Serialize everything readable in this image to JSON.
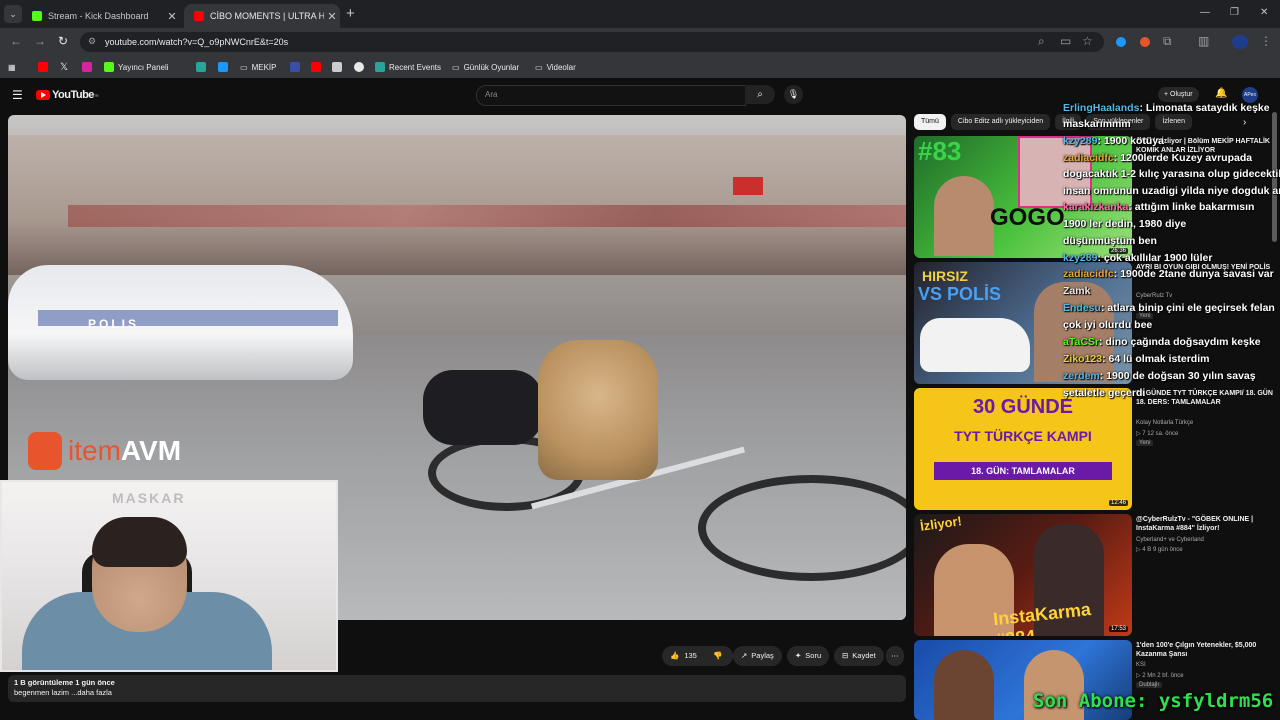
{
  "browser": {
    "tabs": [
      {
        "title": "Stream - Kick Dashboard",
        "favicon_color": "#53fc18"
      },
      {
        "title": "CİBO MOMENTS | ULTRA HIZLI",
        "favicon_color": "#ff0000"
      }
    ],
    "new_tab": "+",
    "url": "youtube.com/watch?v=Q_o9pNWCnrE&t=20s",
    "bookmarks": [
      {
        "label": "",
        "icon": "youtube-icon",
        "color": "#ff0000"
      },
      {
        "label": "",
        "icon": "x-icon",
        "color": "#ffffff"
      },
      {
        "label": "",
        "icon": "instagram-icon",
        "color": "#d6249f"
      },
      {
        "label": "Yayıncı Paneli",
        "icon": "kick-icon",
        "color": "#53fc18"
      },
      {
        "label": "",
        "icon": "app-icon",
        "color": "#27a59a"
      },
      {
        "label": "",
        "icon": "prime-icon",
        "color": "#1a98ff"
      },
      {
        "label": "MEKİP",
        "icon": "folder-icon",
        "color": "#9aa0a6"
      },
      {
        "label": "",
        "icon": "site-icon",
        "color": "#3b4fa8"
      },
      {
        "label": "",
        "icon": "youtube-icon",
        "color": "#ff0000"
      },
      {
        "label": "",
        "icon": "tool-icon",
        "color": "#cccccc"
      },
      {
        "label": "",
        "icon": "obs-icon",
        "color": "#e8e8e8"
      },
      {
        "label": "Recent Events",
        "icon": "events-icon",
        "color": "#27a59a"
      },
      {
        "label": "Günlük Oyunlar",
        "icon": "folder-icon",
        "color": "#9aa0a6"
      },
      {
        "label": "Videolar",
        "icon": "folder-icon",
        "color": "#9aa0a6"
      }
    ]
  },
  "youtube": {
    "logo": "YouTube",
    "logo_sup": "TR",
    "search_placeholder": "Ara",
    "create_label": "+ Oluştur",
    "avatar_label": "APex"
  },
  "video": {
    "overlay_brand_1": "item",
    "overlay_brand_2": "AVM",
    "car_text": "POLIS",
    "webcam_watermark": "MASKAR",
    "likes": "135",
    "share_label": "Paylaş",
    "ask_label": "Soru",
    "save_label": "Kaydet",
    "more_label": "⋯",
    "desc_line1": "1 B görüntüleme  1 gün önce",
    "desc_line2": "begenmen lazim ...daha fazla"
  },
  "sidebar": {
    "chips": [
      "Tümü",
      "Cibo Editz adlı yükleyiciden",
      "İlgili",
      "Son yüklenenler",
      "İzlenen"
    ],
    "videos": [
      {
        "thumb_text": "#83 GOGO İZ",
        "duration": "26:36",
        "title": "1900 lü İzliyor | Bölüm MEKİP HAFTALİK KOMİK ANLAR İZLİYOR",
        "channel": "Cibo Editz",
        "stats": "",
        "badge": "Yeni"
      },
      {
        "thumb_text": "HIRSIZ VS POLİS",
        "duration": "",
        "title": "AYRI BI OYUN GIBI OLMUŞ! YENİ POLİS",
        "channel": "CyberRulz Tv",
        "stats": "",
        "badge": "Yeni"
      },
      {
        "thumb_text": "30 GÜNDE TYT TÜRKÇE KAMPI · 18. GÜN: TAMLAMALAR",
        "duration": "12:46",
        "title": "30 GÜNDE TYT TÜRKÇE KAMPI/ 18. GÜN 18. DERS: TAMLAMALAR",
        "channel": "Kolay Notlarla Türkçe",
        "stats": "▷ 7  12 sa. önce",
        "badge": "Yeni"
      },
      {
        "thumb_text": "İzliyor! InstaKarma #884",
        "duration": "17:53",
        "title": "@CyberRulzTv - \"GÖBEK ONLINE | InstaKarma #884\" İzliyor!",
        "channel": "Cyberland+ ve Cyberland",
        "stats": "▷ 4 B  9 gün önce",
        "badge": ""
      },
      {
        "thumb_text": "",
        "duration": "",
        "title": "1'den 100'e Çılgın Yetenekler, $5,000 Kazanma Şansı",
        "channel": "KSI",
        "stats": "▷ 2 Mn  2 bf. önce",
        "badge": "Dublajlı"
      }
    ]
  },
  "chat": [
    {
      "user": "ErlingHaalands",
      "msg": ": Limonata sataydık keşke",
      "color": "#53b8e8"
    },
    {
      "user": "",
      "msg": "maskarımmm",
      "color": "#ffffff"
    },
    {
      "user": "kzy289",
      "msg": ": 1900 kötüya",
      "color": "#53b8e8"
    },
    {
      "user": "zadiacidfc",
      "msg": ": 1200lerde Kuzey avrupada",
      "color": "#e8a53b"
    },
    {
      "user": "",
      "msg": "dogacaktık 1-2 kılıç yarasına olup gidecektik",
      "color": "#ffffff"
    },
    {
      "user": "",
      "msg": "insan omrunun uzadigi yilda niye dogduk amk",
      "color": "#ffffff"
    },
    {
      "user": "karakizkanka",
      "msg": ": attığım linke bakarmısın",
      "color": "#ff6aa2"
    },
    {
      "user": "",
      "msg": "1900 ler dedin, 1980 diye",
      "color": "#ffffff"
    },
    {
      "user": "",
      "msg": "düşünmüştüm ben",
      "color": "#ffffff"
    },
    {
      "user": "kzy289",
      "msg": ": çok akıllılar 1900 lüler",
      "color": "#53b8e8"
    },
    {
      "user": "zadiacidfc",
      "msg": ": 1900de 2tane dunya savasi var",
      "color": "#e8a53b"
    },
    {
      "user": "Zamk",
      "msg": "",
      "color": "#e8e8e8"
    },
    {
      "user": "Endesu",
      "msg": ": atlara binip çini ele geçirsek felan",
      "color": "#53b8e8"
    },
    {
      "user": "",
      "msg": "çok iyi olurdu bee",
      "color": "#ffffff"
    },
    {
      "user": "aTaCSr",
      "msg": ": dino çağında doğsaydım keşke",
      "color": "#53fc18"
    },
    {
      "user": "Ziko123",
      "msg": ": 64 lü olmak isterdim",
      "color": "#e8d23b"
    },
    {
      "user": "zerdem",
      "msg": ": 1900 de doğsan 30 yılın savaş",
      "color": "#53b8e8"
    },
    {
      "user": "",
      "msg": "şetaletle geçerdi",
      "color": "#ffffff"
    }
  ],
  "footer": {
    "son_abone_label": "Son Abone:",
    "son_abone_user": "ysfyldrm56"
  }
}
